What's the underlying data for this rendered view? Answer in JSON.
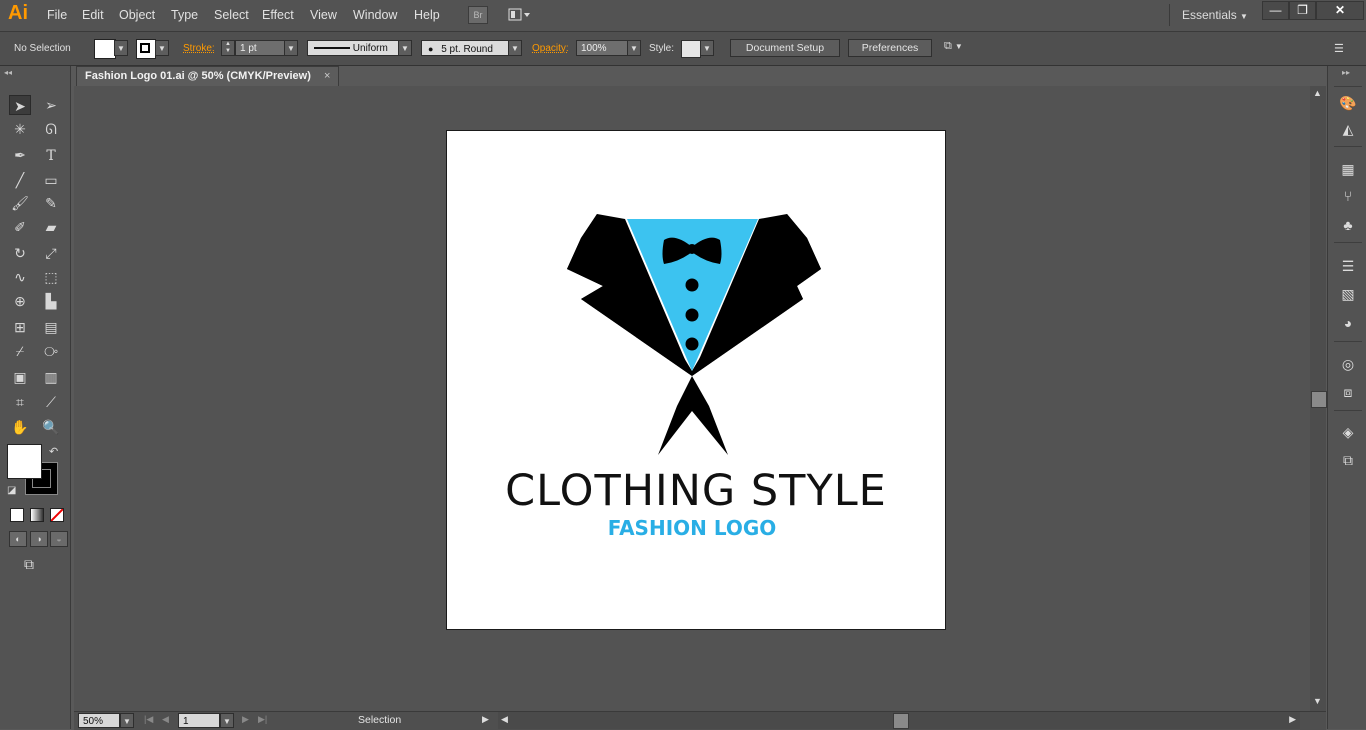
{
  "app": {
    "logo": "Ai"
  },
  "menu": [
    "File",
    "Edit",
    "Object",
    "Type",
    "Select",
    "Effect",
    "View",
    "Window",
    "Help"
  ],
  "bridge_label": "Br",
  "workspace": "Essentials",
  "control": {
    "selection": "No Selection",
    "stroke_label": "Stroke:",
    "stroke_weight": "1 pt",
    "profile": "Uniform",
    "brush": "5 pt. Round",
    "opacity_label": "Opacity:",
    "opacity": "100%",
    "style_label": "Style:",
    "document_setup": "Document Setup",
    "preferences": "Preferences"
  },
  "document": {
    "tab_title": "Fashion Logo 01.ai @ 50% (CMYK/Preview)",
    "close": "×"
  },
  "artwork": {
    "title": "CLOTHING STYLE",
    "subtitle": "FASHION LOGO",
    "colors": {
      "accent": "#3cc3f0",
      "black": "#000000",
      "sub": "#29aee5"
    }
  },
  "status": {
    "zoom": "50%",
    "page": "1",
    "tool": "Selection"
  }
}
